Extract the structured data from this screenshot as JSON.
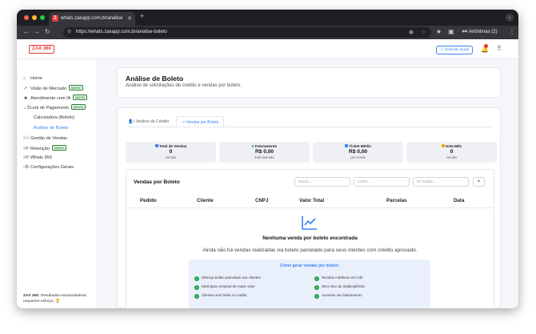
{
  "browser": {
    "tab_title": "whats.zaxapp.com.br/analise",
    "new_tab": "+",
    "url": "https://whats.zaxapp.com.br/analise-boleto",
    "profile": "Anônimas (2)"
  },
  "colors": {
    "accent": "#3b82f6",
    "brand": "#e53935",
    "success": "#22a34a"
  },
  "header": {
    "logo": "ZAX 360",
    "help_button": "Solicitar Ajuda",
    "notifications": "1"
  },
  "sidebar": {
    "items": [
      {
        "icon": "home-icon",
        "label": "Home"
      },
      {
        "icon": "chart-icon",
        "label": "Visão de Mercado",
        "badge": "NOVO"
      },
      {
        "icon": "robot-icon",
        "label": "Atendimento com IA",
        "badge": "NOVO"
      },
      {
        "icon": "dollar-icon",
        "label": "Link de Pagamento",
        "badge": "NOVO"
      },
      {
        "icon": "users-icon",
        "label": "Gestão de Vendas"
      },
      {
        "icon": "retention-icon",
        "label": "Retenção",
        "badge": "NOVO"
      },
      {
        "icon": "megaphone-icon",
        "label": "Whats 360"
      },
      {
        "icon": "gear-icon",
        "label": "Configurações Gerais"
      }
    ],
    "subitems": [
      "Calculadora (Boleto)",
      "Análise de Boleto"
    ],
    "footer_bold": "ZAX 360:",
    "footer_text": "Resultados extraordinários requerem esforço. 🏆"
  },
  "page": {
    "title": "Análise de Boleto",
    "subtitle": "Análise de solicitações de crédito e vendas por boleto."
  },
  "tabs": [
    "Análise de Crédito",
    "Vendas por Boleto"
  ],
  "stats": [
    {
      "label": "Total de Vendas",
      "value": "0",
      "sub": "vendas",
      "color": "#3b82f6"
    },
    {
      "label": "Faturamento",
      "value": "R$ 0,00",
      "sub": "total faturado",
      "color": "#22a34a"
    },
    {
      "label": "Ticket Médio",
      "value": "R$ 0,00",
      "sub": "por venda",
      "color": "#3b82f6"
    },
    {
      "label": "Este Mês",
      "value": "0",
      "sub": "vendas",
      "color": "#f59e0b"
    }
  ],
  "sales": {
    "title": "Vendas por Boleto",
    "filters": {
      "name": "Nome...",
      "cnpj": "CNPJ...",
      "order": "Nº Pedido..."
    },
    "clear": "×",
    "columns": [
      "Pedido",
      "Cliente",
      "CNPJ",
      "Valor Total",
      "Parcelas",
      "Data"
    ],
    "empty_title": "Nenhuma venda por boleto encontrada",
    "empty_text": "Ainda não há vendas realizadas via boleto parcelado para seus clientes com crédito aprovado.",
    "how_title": "Como gerar vendas por boleto:",
    "tips": [
      "Ofereça boleto parcelado aos clientes",
      "Receba o dinheiro em 24h",
      "Ideal para compras de maior valor",
      "Zero risco de inadimplência",
      "Clientes sem limite no cartão",
      "Aumente seu faturamento"
    ]
  }
}
